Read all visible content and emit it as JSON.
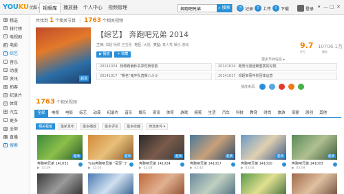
{
  "app": {
    "logo": {
      "part1": "YOU",
      "part2": "KU",
      "text": "优酷",
      "dropdown": "▾"
    },
    "nav": [
      "视频库",
      "播放器",
      "个人中心",
      "视频管理"
    ],
    "search": {
      "value": "奔跑吧兄弟",
      "button": "搜索"
    },
    "tools": [
      {
        "icon": "clock-icon",
        "glyph": "◷",
        "label": "记录"
      },
      {
        "icon": "upload-icon",
        "glyph": "⇧",
        "label": "上传"
      },
      {
        "icon": "download-icon",
        "glyph": "⇩",
        "label": "下载"
      },
      {
        "icon": "avatar-icon",
        "glyph": "",
        "label": "登录"
      }
    ],
    "window_controls": [
      "▾",
      "—",
      "□",
      "✕"
    ]
  },
  "sidebar": [
    {
      "label": "精选",
      "glyph": "▣",
      "icon": "featured-icon"
    },
    {
      "label": "排行榜",
      "glyph": "≡",
      "icon": "ranking-icon"
    },
    {
      "label": "电视剧",
      "glyph": "▭",
      "icon": "tv-icon"
    },
    {
      "label": "电影",
      "glyph": "▶",
      "icon": "movie-icon"
    },
    {
      "label": "综艺",
      "glyph": "☆",
      "icon": "variety-icon",
      "active": true
    },
    {
      "label": "音乐",
      "glyph": "♪",
      "icon": "music-icon"
    },
    {
      "label": "动漫",
      "glyph": "☺",
      "icon": "anime-icon"
    },
    {
      "label": "资讯",
      "glyph": "▤",
      "icon": "news-icon"
    },
    {
      "label": "拍客",
      "glyph": "◉",
      "icon": "camera-icon"
    },
    {
      "label": "纪录片",
      "glyph": "▥",
      "icon": "documentary-icon"
    },
    {
      "label": "体育",
      "glyph": "◎",
      "icon": "sports-icon"
    },
    {
      "label": "汽车",
      "glyph": "◆",
      "icon": "car-icon"
    },
    {
      "label": "更多",
      "glyph": "…",
      "icon": "more-icon"
    },
    {
      "label": "全部",
      "glyph": "▦",
      "icon": "all-icon"
    },
    {
      "label": "直播",
      "glyph": "●",
      "icon": "live-icon"
    },
    {
      "label": "搜索",
      "glyph": "⌕",
      "icon": "search-icon",
      "active": true
    }
  ],
  "crumb": {
    "prefix": "共找到",
    "n1": "1",
    "mid": "个相关节目",
    "n2": "1763",
    "suffix": "个相关视频"
  },
  "show": {
    "title": "【综艺】 奔跑吧兄弟 2014",
    "poster_badge": "超清",
    "meta": [
      {
        "k": "主持:",
        "v": "邓超 杨颖 王宝强"
      },
      {
        "k": "地区:",
        "v": "大陆"
      },
      {
        "k": "类型:",
        "v": "真人秀 娱乐 游戏"
      }
    ],
    "buttons": [
      "播放",
      "收藏"
    ],
    "score": "9.7",
    "score_label": "评分",
    "plays": "10706.1万",
    "plays_label": "播放",
    "more": "更多节目信息 ▸",
    "episodes": [
      {
        "date": "20141024",
        "text": "杨颖跑偏秒杀郑恺杨忠韵"
      },
      {
        "date": "20141024",
        "text": "跑男兄弟团聚重案的好媳"
      },
      {
        "date": "20141017",
        "text": "“撕名”鬼冲队直撕八斗斗"
      },
      {
        "date": "20141017",
        "text": "邓超宰著叫你团体运营"
      }
    ],
    "play_labels": [
      "播放",
      "收藏"
    ],
    "site_label": "播放来源:"
  },
  "videos": {
    "count": "1763",
    "count_label": "个相关视频",
    "tabs": [
      "全部",
      "电视",
      "电影",
      "综艺",
      "动漫",
      "纪录片",
      "音乐",
      "娱乐",
      "资讯",
      "体育",
      "游戏",
      "搞笑",
      "生活",
      "汽车",
      "科技",
      "教育",
      "时尚",
      "旅游",
      "母婴",
      "原创",
      "其他"
    ],
    "filters": [
      "相关程度",
      "最新发布",
      "最多播放",
      "最多评论",
      "最多收藏",
      "筛选条件 ▾"
    ],
    "cards": [
      {
        "title": "奔跑吧兄弟 141031",
        "stat": "03:09",
        "hd": "超清"
      },
      {
        "title": "Yula奔跑吧兄弟 “冠军”了",
        "stat": "15:03",
        "hd": "超清"
      },
      {
        "title": "奔跑吧兄弟 141024",
        "stat": "03:08",
        "hd": "超清"
      },
      {
        "title": "奔跑吧兄弟 141017",
        "stat": "02:40",
        "hd": "超清"
      },
      {
        "title": "奔跑吧兄弟 141010",
        "stat": "03:04",
        "hd": "超清"
      },
      {
        "title": "奔跑吧兄弟 141003",
        "stat": "03:09",
        "hd": "超清"
      },
      {
        "title": "",
        "stat": "",
        "hd": ""
      },
      {
        "title": "",
        "stat": "",
        "hd": ""
      },
      {
        "title": "",
        "stat": "",
        "hd": ""
      },
      {
        "title": "",
        "stat": "",
        "hd": ""
      },
      {
        "title": "",
        "stat": "",
        "hd": ""
      },
      {
        "title": "",
        "stat": "",
        "hd": ""
      }
    ]
  },
  "colors": {
    "accent": "#2a8fd8",
    "orange": "#f28000"
  }
}
